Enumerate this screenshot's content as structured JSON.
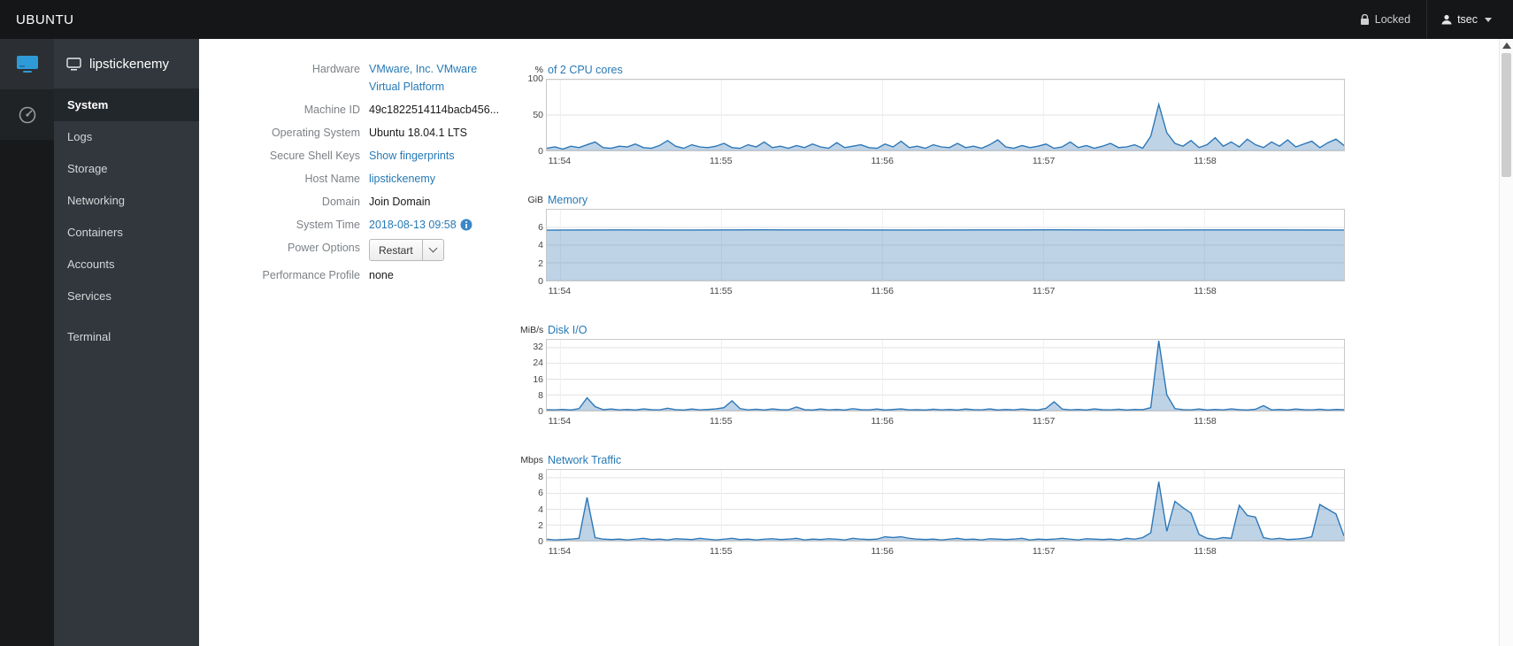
{
  "topbar": {
    "brand": "UBUNTU",
    "locked": "Locked",
    "user": "tsec"
  },
  "sidebar": {
    "host": "lipstickenemy",
    "items": [
      "System",
      "Logs",
      "Storage",
      "Networking",
      "Containers",
      "Accounts",
      "Services"
    ],
    "terminal": "Terminal",
    "active": "System"
  },
  "info": {
    "rows": [
      {
        "label": "Hardware",
        "value": "VMware, Inc. VMware Virtual Platform"
      },
      {
        "label": "Machine ID",
        "value": "49c1822514114bacb456..."
      },
      {
        "label": "Operating System",
        "value": "Ubuntu 18.04.1 LTS"
      },
      {
        "label": "Secure Shell Keys",
        "value": "Show fingerprints"
      },
      {
        "label": "Host Name",
        "value": "lipstickenemy"
      },
      {
        "label": "Domain",
        "value": "Join Domain"
      },
      {
        "label": "System Time",
        "value": "2018-08-13 09:58"
      },
      {
        "label": "Power Options",
        "value": "Restart"
      },
      {
        "label": "Performance Profile",
        "value": "none"
      }
    ]
  },
  "colors": {
    "accent_blue": "#2679b5",
    "chart_stroke": "#2b77b8",
    "chart_fill": "rgba(56,118,177,0.32)"
  },
  "chart_data": [
    {
      "type": "area",
      "unit": "%",
      "title": "of 2 CPU cores",
      "ymax": 100,
      "yticks": [
        100,
        50,
        0
      ],
      "x_labels": [
        "11:54",
        "11:55",
        "11:56",
        "11:57",
        "11:58"
      ],
      "x_label_fracs": [
        0.017,
        0.219,
        0.421,
        0.623,
        0.825
      ],
      "stroke": "#2b77b8",
      "fill": "rgba(56,118,177,0.32)",
      "values": [
        3,
        5,
        2,
        6,
        4,
        8,
        12,
        4,
        3,
        6,
        5,
        9,
        4,
        3,
        7,
        14,
        6,
        3,
        8,
        5,
        4,
        6,
        10,
        4,
        3,
        8,
        5,
        12,
        4,
        6,
        3,
        7,
        4,
        9,
        5,
        3,
        11,
        4,
        6,
        8,
        4,
        3,
        9,
        5,
        13,
        4,
        6,
        3,
        8,
        5,
        4,
        10,
        4,
        6,
        3,
        8,
        15,
        5,
        3,
        7,
        4,
        6,
        9,
        3,
        5,
        12,
        4,
        7,
        3,
        6,
        10,
        4,
        5,
        8,
        3,
        20,
        65,
        25,
        10,
        6,
        14,
        4,
        8,
        18,
        6,
        12,
        5,
        16,
        8,
        4,
        12,
        6,
        15,
        5,
        9,
        13,
        4,
        11,
        16,
        7
      ]
    },
    {
      "type": "area",
      "unit": "GiB",
      "title": "Memory",
      "ymax": 8,
      "yticks": [
        6,
        4,
        2,
        0
      ],
      "x_labels": [
        "11:54",
        "11:55",
        "11:56",
        "11:57",
        "11:58"
      ],
      "x_label_fracs": [
        0.017,
        0.219,
        0.421,
        0.623,
        0.825
      ],
      "stroke": "#2b77b8",
      "fill": "rgba(56,118,177,0.32)",
      "values": [
        5.7,
        5.72,
        5.71,
        5.73,
        5.72,
        5.71,
        5.72,
        5.73,
        5.71,
        5.72,
        5.72,
        5.71
      ]
    },
    {
      "type": "area",
      "unit": "MiB/s",
      "title": "Disk I/O",
      "ymax": 36,
      "yticks": [
        32,
        24,
        16,
        8,
        0
      ],
      "x_labels": [
        "11:54",
        "11:55",
        "11:56",
        "11:57",
        "11:58"
      ],
      "x_label_fracs": [
        0.017,
        0.219,
        0.421,
        0.623,
        0.825
      ],
      "stroke": "#2b77b8",
      "fill": "rgba(56,118,177,0.32)",
      "values": [
        0.5,
        0.4,
        0.6,
        0.3,
        1.0,
        6.5,
        2.0,
        0.5,
        0.8,
        0.4,
        0.6,
        0.3,
        0.9,
        0.5,
        0.4,
        1.2,
        0.5,
        0.3,
        0.8,
        0.4,
        0.6,
        0.9,
        1.5,
        5.0,
        1.0,
        0.4,
        0.7,
        0.3,
        0.9,
        0.5,
        0.4,
        1.8,
        0.5,
        0.3,
        0.8,
        0.4,
        0.6,
        0.3,
        1.0,
        0.5,
        0.4,
        0.8,
        0.3,
        0.6,
        0.9,
        0.4,
        0.5,
        0.3,
        0.7,
        0.4,
        0.6,
        0.3,
        0.8,
        0.5,
        0.4,
        0.9,
        0.3,
        0.6,
        0.4,
        0.8,
        0.5,
        0.3,
        1.2,
        4.5,
        0.8,
        0.4,
        0.6,
        0.3,
        0.9,
        0.5,
        0.4,
        0.7,
        0.3,
        0.6,
        0.5,
        1.5,
        35.5,
        8.0,
        1.0,
        0.5,
        0.4,
        0.8,
        0.3,
        0.6,
        0.4,
        0.9,
        0.5,
        0.3,
        0.7,
        2.5,
        0.4,
        0.6,
        0.3,
        0.8,
        0.5,
        0.4,
        0.7,
        0.3,
        0.6,
        0.5
      ]
    },
    {
      "type": "area",
      "unit": "Mbps",
      "title": "Network Traffic",
      "ymax": 9,
      "yticks": [
        8,
        6,
        4,
        2,
        0
      ],
      "x_labels": [
        "11:54",
        "11:55",
        "11:56",
        "11:57",
        "11:58"
      ],
      "x_label_fracs": [
        0.017,
        0.219,
        0.421,
        0.623,
        0.825
      ],
      "stroke": "#2b77b8",
      "fill": "rgba(56,118,177,0.32)",
      "values": [
        0.2,
        0.1,
        0.15,
        0.2,
        0.3,
        5.5,
        0.4,
        0.2,
        0.15,
        0.2,
        0.1,
        0.2,
        0.3,
        0.15,
        0.2,
        0.1,
        0.25,
        0.2,
        0.15,
        0.3,
        0.2,
        0.1,
        0.2,
        0.3,
        0.15,
        0.2,
        0.1,
        0.2,
        0.25,
        0.15,
        0.2,
        0.3,
        0.1,
        0.2,
        0.15,
        0.25,
        0.2,
        0.1,
        0.3,
        0.2,
        0.15,
        0.2,
        0.5,
        0.4,
        0.5,
        0.3,
        0.2,
        0.15,
        0.2,
        0.1,
        0.2,
        0.3,
        0.15,
        0.2,
        0.1,
        0.25,
        0.2,
        0.15,
        0.2,
        0.3,
        0.1,
        0.2,
        0.15,
        0.2,
        0.3,
        0.2,
        0.1,
        0.25,
        0.2,
        0.15,
        0.2,
        0.1,
        0.3,
        0.2,
        0.4,
        1.0,
        7.5,
        1.2,
        5.0,
        4.2,
        3.5,
        0.8,
        0.3,
        0.2,
        0.4,
        0.3,
        4.5,
        3.2,
        3.0,
        0.4,
        0.2,
        0.3,
        0.15,
        0.2,
        0.3,
        0.5,
        4.6,
        4.0,
        3.4,
        0.6
      ]
    }
  ]
}
